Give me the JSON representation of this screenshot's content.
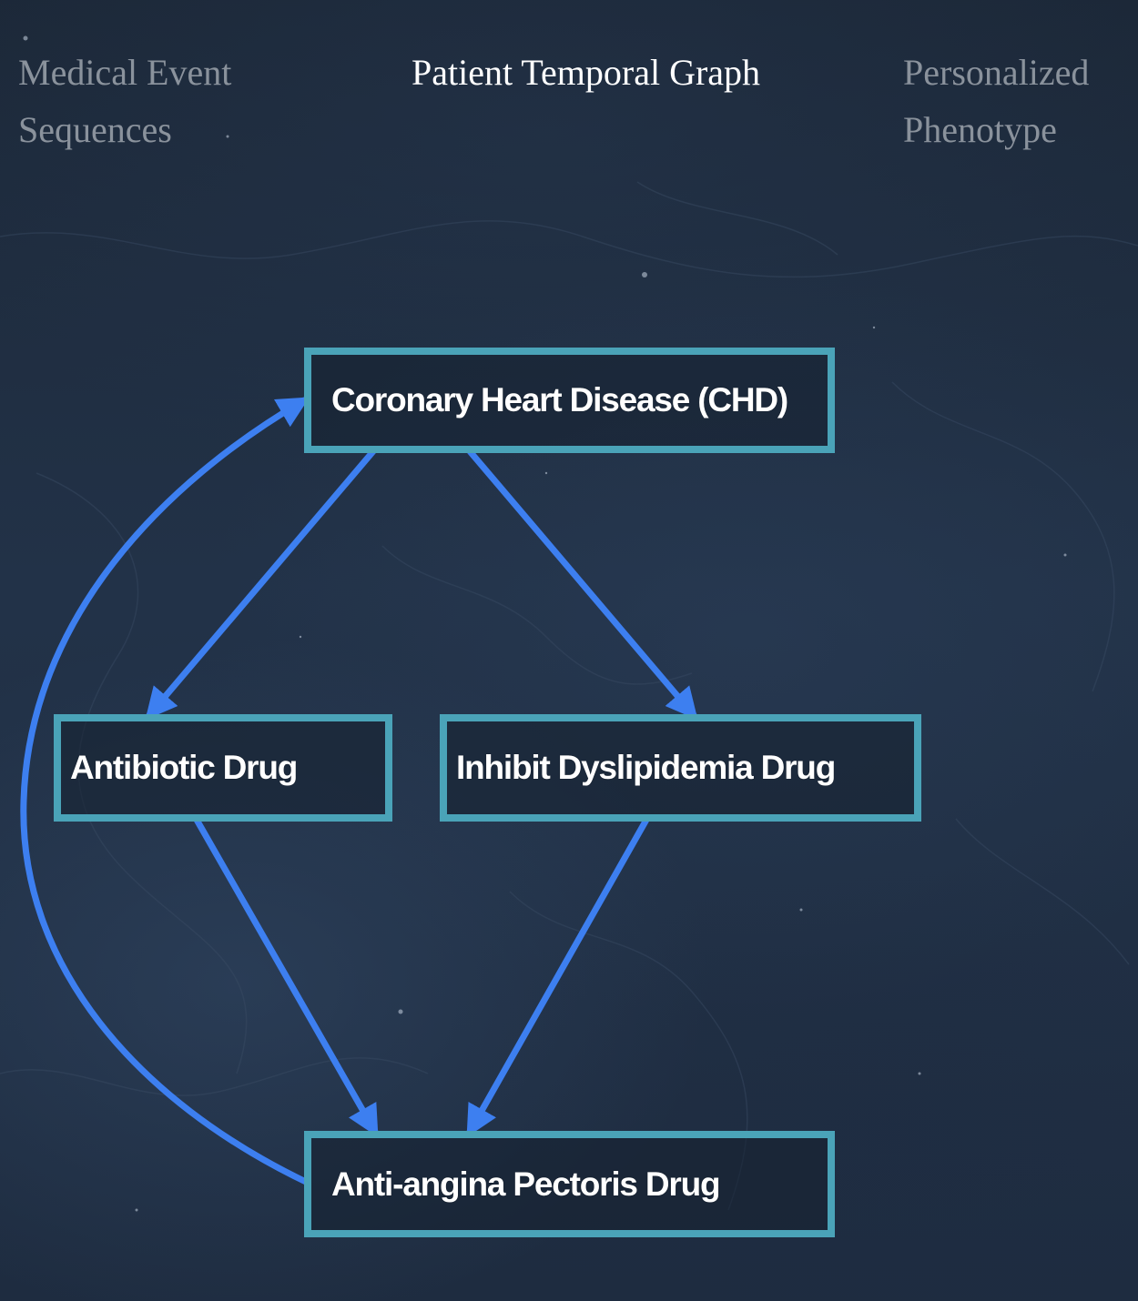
{
  "tabs": [
    {
      "label": "Medical Event Sequences",
      "active": false
    },
    {
      "label": "Patient Temporal Graph",
      "active": true
    },
    {
      "label": "Personalized Phenotype",
      "active": false
    }
  ],
  "graph": {
    "nodes": [
      {
        "id": "chd",
        "label": "Coronary Heart Disease (CHD)"
      },
      {
        "id": "antibiotic",
        "label": "Antibiotic Drug"
      },
      {
        "id": "dyslipidemia",
        "label": "Inhibit Dyslipidemia Drug"
      },
      {
        "id": "angina",
        "label": "Anti-angina Pectoris Drug"
      }
    ],
    "edges": [
      {
        "from": "chd",
        "to": "antibiotic"
      },
      {
        "from": "chd",
        "to": "dyslipidemia"
      },
      {
        "from": "antibiotic",
        "to": "angina"
      },
      {
        "from": "dyslipidemia",
        "to": "angina"
      },
      {
        "from": "angina",
        "to": "chd"
      }
    ]
  },
  "colors": {
    "background": "#1d2a3c",
    "node_border": "#4aa3b8",
    "edge": "#3d7ff0",
    "active_tab_text": "#ffffff",
    "inactive_tab_text": "#8a929c"
  }
}
